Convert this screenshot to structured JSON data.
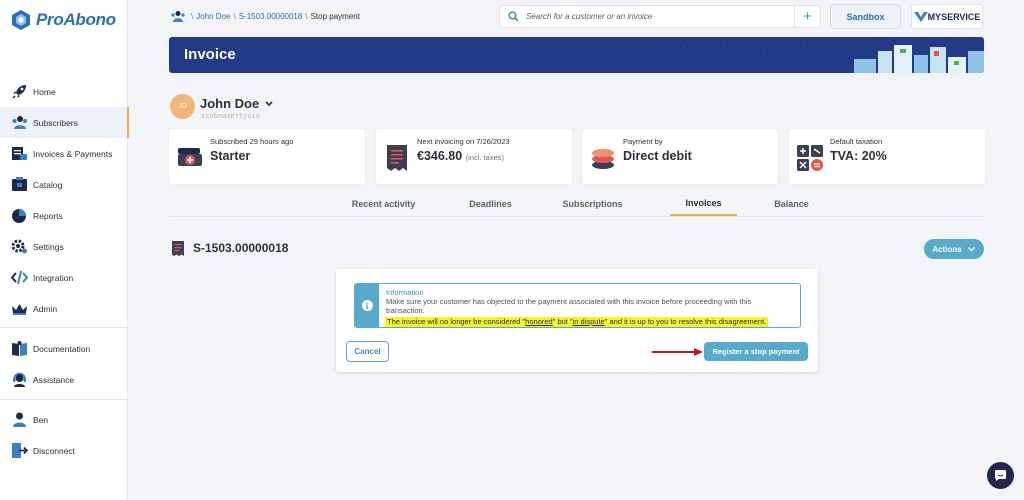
{
  "brand": {
    "name": "ProAbono"
  },
  "sidebar": {
    "items": [
      {
        "label": "Home",
        "icon": "rocket-icon"
      },
      {
        "label": "Subscribers",
        "icon": "subscribers-icon",
        "active": true
      },
      {
        "label": "Invoices & Payments",
        "icon": "invoices-icon"
      },
      {
        "label": "Catalog",
        "icon": "catalog-icon"
      },
      {
        "label": "Reports",
        "icon": "pie-chart-icon"
      },
      {
        "label": "Settings",
        "icon": "gear-icon"
      },
      {
        "label": "Integration",
        "icon": "code-icon"
      },
      {
        "label": "Admin",
        "icon": "crown-icon"
      }
    ],
    "help_items": [
      {
        "label": "Documentation",
        "icon": "book-icon"
      },
      {
        "label": "Assistance",
        "icon": "headset-icon"
      }
    ],
    "user_items": [
      {
        "label": "Ben",
        "icon": "user-icon"
      },
      {
        "label": "Disconnect",
        "icon": "logout-icon"
      }
    ]
  },
  "breadcrumb": {
    "items": [
      "John Doe",
      "S-1503.00000018"
    ],
    "current": "Stop payment"
  },
  "search": {
    "placeholder": "Search for a customer or an invoice",
    "value": ""
  },
  "header": {
    "sandbox_label": "Sandbox",
    "service_label": "MYSERVICE"
  },
  "banner": {
    "title": "Invoice"
  },
  "customer": {
    "initials": "JD",
    "name": "John Doe",
    "reference": "scvbnazertyuio"
  },
  "cards": [
    {
      "label": "Subscribed 29 hours ago",
      "value": "Starter",
      "suffix": "",
      "icon": "subscription-icon"
    },
    {
      "label": "Next invoicing on 7/26/2023",
      "value": "€346.80",
      "suffix": "(incl. taxes)",
      "icon": "receipt-icon"
    },
    {
      "label": "Payment by",
      "value": "Direct debit",
      "suffix": "",
      "icon": "coins-icon"
    },
    {
      "label": "Default taxation",
      "value": "TVA: 20%",
      "suffix": "",
      "icon": "calculator-icon"
    }
  ],
  "tabs": [
    {
      "label": "Recent activity",
      "active": false
    },
    {
      "label": "Deadlines",
      "active": false
    },
    {
      "label": "Subscriptions",
      "active": false
    },
    {
      "label": "Invoices",
      "active": true
    },
    {
      "label": "Balance",
      "active": false
    }
  ],
  "invoice": {
    "number": "S-1503.00000018",
    "actions_label": "Actions"
  },
  "modal": {
    "info_title": "Information",
    "info_text": "Make sure your customer has objected to the payment associated with this invoice before proceeding with this transaction.",
    "highlight": {
      "part1": "The invoice will no longer be considered \"",
      "term1": "honored",
      "part2": "\" but \"",
      "term2": "in dispute",
      "part3": "\" and it is up to you to resolve this disagreement."
    },
    "cancel_label": "Cancel",
    "confirm_label": "Register a stop payment"
  },
  "colors": {
    "accent": "#57aac9",
    "brand": "#2d6fb6",
    "banner": "#233b87",
    "highlight": "#f6f32a",
    "active_tab": "#f2a65a",
    "arrow": "#c0181e"
  }
}
